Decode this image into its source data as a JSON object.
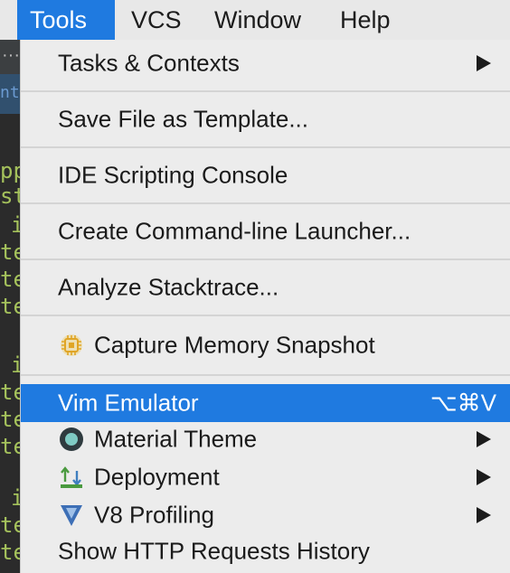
{
  "menubar": {
    "items": [
      {
        "label": "Tools",
        "active": true
      },
      {
        "label": "VCS",
        "active": false
      },
      {
        "label": "Window",
        "active": false
      },
      {
        "label": "Help",
        "active": false
      }
    ]
  },
  "editor": {
    "fragments": [
      "nt",
      "pp",
      "st",
      "i",
      "te",
      "te",
      "te",
      "i",
      "te",
      "te",
      "te",
      "i",
      "te",
      "te"
    ]
  },
  "tools_menu": {
    "items": [
      {
        "label": "Tasks & Contexts",
        "submenu": true
      },
      {
        "label": "Save File as Template..."
      },
      {
        "label": "IDE Scripting Console"
      },
      {
        "label": "Create Command-line Launcher..."
      },
      {
        "label": "Analyze Stacktrace..."
      },
      {
        "label": "Capture Memory Snapshot",
        "icon": "memory-chip-icon"
      },
      {
        "label": "Vim Emulator",
        "shortcut": "⌥⌘V",
        "highlighted": true
      },
      {
        "label": "Material Theme",
        "icon": "material-theme-icon",
        "submenu": true
      },
      {
        "label": "Deployment",
        "icon": "deployment-icon",
        "submenu": true
      },
      {
        "label": "V8 Profiling",
        "icon": "v8-icon",
        "submenu": true
      },
      {
        "label": "Show HTTP Requests History"
      }
    ]
  },
  "colors": {
    "highlight": "#1f7ae0",
    "menu_background": "#ececec",
    "editor_background": "#2b2b2b"
  }
}
